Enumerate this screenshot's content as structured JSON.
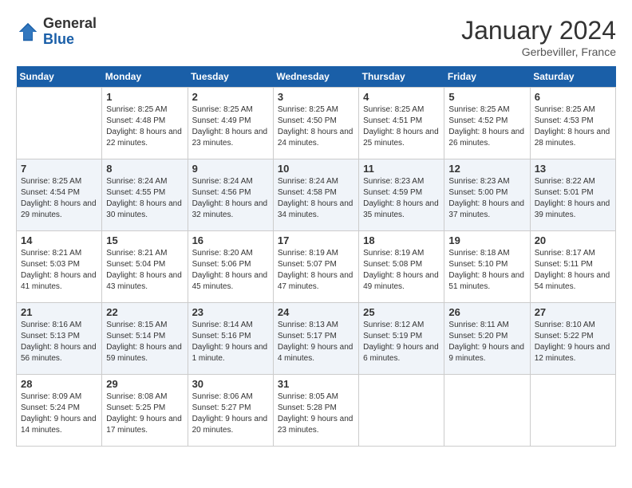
{
  "header": {
    "logo_general": "General",
    "logo_blue": "Blue",
    "month_year": "January 2024",
    "location": "Gerbeviller, France"
  },
  "weekdays": [
    "Sunday",
    "Monday",
    "Tuesday",
    "Wednesday",
    "Thursday",
    "Friday",
    "Saturday"
  ],
  "weeks": [
    [
      {
        "day": "",
        "sunrise": "",
        "sunset": "",
        "daylight": ""
      },
      {
        "day": "1",
        "sunrise": "Sunrise: 8:25 AM",
        "sunset": "Sunset: 4:48 PM",
        "daylight": "Daylight: 8 hours and 22 minutes."
      },
      {
        "day": "2",
        "sunrise": "Sunrise: 8:25 AM",
        "sunset": "Sunset: 4:49 PM",
        "daylight": "Daylight: 8 hours and 23 minutes."
      },
      {
        "day": "3",
        "sunrise": "Sunrise: 8:25 AM",
        "sunset": "Sunset: 4:50 PM",
        "daylight": "Daylight: 8 hours and 24 minutes."
      },
      {
        "day": "4",
        "sunrise": "Sunrise: 8:25 AM",
        "sunset": "Sunset: 4:51 PM",
        "daylight": "Daylight: 8 hours and 25 minutes."
      },
      {
        "day": "5",
        "sunrise": "Sunrise: 8:25 AM",
        "sunset": "Sunset: 4:52 PM",
        "daylight": "Daylight: 8 hours and 26 minutes."
      },
      {
        "day": "6",
        "sunrise": "Sunrise: 8:25 AM",
        "sunset": "Sunset: 4:53 PM",
        "daylight": "Daylight: 8 hours and 28 minutes."
      }
    ],
    [
      {
        "day": "7",
        "sunrise": "Sunrise: 8:25 AM",
        "sunset": "Sunset: 4:54 PM",
        "daylight": "Daylight: 8 hours and 29 minutes."
      },
      {
        "day": "8",
        "sunrise": "Sunrise: 8:24 AM",
        "sunset": "Sunset: 4:55 PM",
        "daylight": "Daylight: 8 hours and 30 minutes."
      },
      {
        "day": "9",
        "sunrise": "Sunrise: 8:24 AM",
        "sunset": "Sunset: 4:56 PM",
        "daylight": "Daylight: 8 hours and 32 minutes."
      },
      {
        "day": "10",
        "sunrise": "Sunrise: 8:24 AM",
        "sunset": "Sunset: 4:58 PM",
        "daylight": "Daylight: 8 hours and 34 minutes."
      },
      {
        "day": "11",
        "sunrise": "Sunrise: 8:23 AM",
        "sunset": "Sunset: 4:59 PM",
        "daylight": "Daylight: 8 hours and 35 minutes."
      },
      {
        "day": "12",
        "sunrise": "Sunrise: 8:23 AM",
        "sunset": "Sunset: 5:00 PM",
        "daylight": "Daylight: 8 hours and 37 minutes."
      },
      {
        "day": "13",
        "sunrise": "Sunrise: 8:22 AM",
        "sunset": "Sunset: 5:01 PM",
        "daylight": "Daylight: 8 hours and 39 minutes."
      }
    ],
    [
      {
        "day": "14",
        "sunrise": "Sunrise: 8:21 AM",
        "sunset": "Sunset: 5:03 PM",
        "daylight": "Daylight: 8 hours and 41 minutes."
      },
      {
        "day": "15",
        "sunrise": "Sunrise: 8:21 AM",
        "sunset": "Sunset: 5:04 PM",
        "daylight": "Daylight: 8 hours and 43 minutes."
      },
      {
        "day": "16",
        "sunrise": "Sunrise: 8:20 AM",
        "sunset": "Sunset: 5:06 PM",
        "daylight": "Daylight: 8 hours and 45 minutes."
      },
      {
        "day": "17",
        "sunrise": "Sunrise: 8:19 AM",
        "sunset": "Sunset: 5:07 PM",
        "daylight": "Daylight: 8 hours and 47 minutes."
      },
      {
        "day": "18",
        "sunrise": "Sunrise: 8:19 AM",
        "sunset": "Sunset: 5:08 PM",
        "daylight": "Daylight: 8 hours and 49 minutes."
      },
      {
        "day": "19",
        "sunrise": "Sunrise: 8:18 AM",
        "sunset": "Sunset: 5:10 PM",
        "daylight": "Daylight: 8 hours and 51 minutes."
      },
      {
        "day": "20",
        "sunrise": "Sunrise: 8:17 AM",
        "sunset": "Sunset: 5:11 PM",
        "daylight": "Daylight: 8 hours and 54 minutes."
      }
    ],
    [
      {
        "day": "21",
        "sunrise": "Sunrise: 8:16 AM",
        "sunset": "Sunset: 5:13 PM",
        "daylight": "Daylight: 8 hours and 56 minutes."
      },
      {
        "day": "22",
        "sunrise": "Sunrise: 8:15 AM",
        "sunset": "Sunset: 5:14 PM",
        "daylight": "Daylight: 8 hours and 59 minutes."
      },
      {
        "day": "23",
        "sunrise": "Sunrise: 8:14 AM",
        "sunset": "Sunset: 5:16 PM",
        "daylight": "Daylight: 9 hours and 1 minute."
      },
      {
        "day": "24",
        "sunrise": "Sunrise: 8:13 AM",
        "sunset": "Sunset: 5:17 PM",
        "daylight": "Daylight: 9 hours and 4 minutes."
      },
      {
        "day": "25",
        "sunrise": "Sunrise: 8:12 AM",
        "sunset": "Sunset: 5:19 PM",
        "daylight": "Daylight: 9 hours and 6 minutes."
      },
      {
        "day": "26",
        "sunrise": "Sunrise: 8:11 AM",
        "sunset": "Sunset: 5:20 PM",
        "daylight": "Daylight: 9 hours and 9 minutes."
      },
      {
        "day": "27",
        "sunrise": "Sunrise: 8:10 AM",
        "sunset": "Sunset: 5:22 PM",
        "daylight": "Daylight: 9 hours and 12 minutes."
      }
    ],
    [
      {
        "day": "28",
        "sunrise": "Sunrise: 8:09 AM",
        "sunset": "Sunset: 5:24 PM",
        "daylight": "Daylight: 9 hours and 14 minutes."
      },
      {
        "day": "29",
        "sunrise": "Sunrise: 8:08 AM",
        "sunset": "Sunset: 5:25 PM",
        "daylight": "Daylight: 9 hours and 17 minutes."
      },
      {
        "day": "30",
        "sunrise": "Sunrise: 8:06 AM",
        "sunset": "Sunset: 5:27 PM",
        "daylight": "Daylight: 9 hours and 20 minutes."
      },
      {
        "day": "31",
        "sunrise": "Sunrise: 8:05 AM",
        "sunset": "Sunset: 5:28 PM",
        "daylight": "Daylight: 9 hours and 23 minutes."
      },
      {
        "day": "",
        "sunrise": "",
        "sunset": "",
        "daylight": ""
      },
      {
        "day": "",
        "sunrise": "",
        "sunset": "",
        "daylight": ""
      },
      {
        "day": "",
        "sunrise": "",
        "sunset": "",
        "daylight": ""
      }
    ]
  ]
}
